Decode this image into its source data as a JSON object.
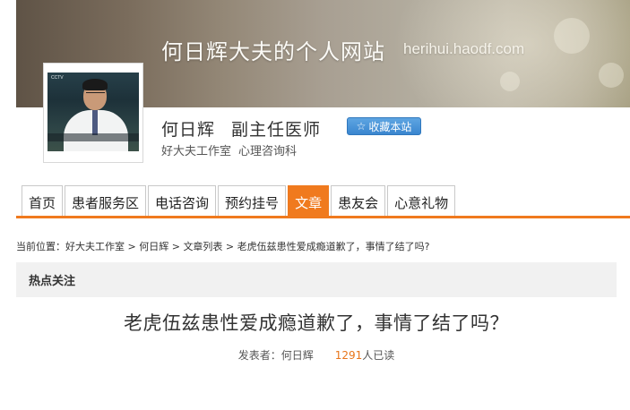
{
  "header": {
    "site_title": "何日辉大夫的个人网站",
    "site_url": "herihui.haodf.com",
    "doctor_name": "何日辉",
    "doctor_title": "副主任医师",
    "bookmark_label": "收藏本站",
    "studio": "好大夫工作室",
    "department": "心理咨询科"
  },
  "nav": {
    "tabs": [
      "首页",
      "患者服务区",
      "电话咨询",
      "预约挂号",
      "文章",
      "患友会",
      "心意礼物"
    ],
    "active_index": 4,
    "accent_color": "#f07a1e"
  },
  "breadcrumb": {
    "prefix": "当前位置：",
    "items": [
      "好大夫工作室",
      "何日辉",
      "文章列表",
      "老虎伍兹患性爱成瘾道歉了，事情了结了吗?"
    ],
    "separator": " > "
  },
  "section": {
    "hot_label": "热点关注"
  },
  "article": {
    "title": "老虎伍兹患性爱成瘾道歉了，事情了结了吗？",
    "author_label": "发表者：何日辉",
    "reads_count": "1291",
    "reads_suffix": "人已读"
  }
}
